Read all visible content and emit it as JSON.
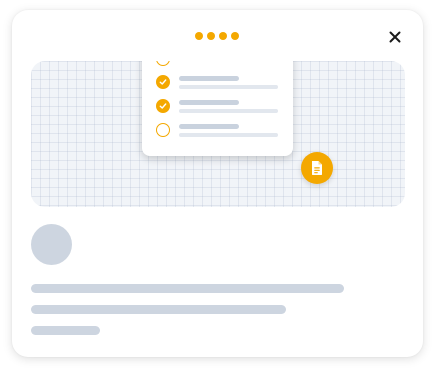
{
  "modal": {
    "step_indicator": {
      "total_steps": 4,
      "active_color": "#f4a800"
    },
    "close_icon": "close-icon",
    "illustration": {
      "checklist": [
        {
          "checked": false
        },
        {
          "checked": true
        },
        {
          "checked": true
        },
        {
          "checked": false
        }
      ],
      "badge_icon": "document-icon",
      "accent_color": "#f4a800"
    },
    "content": {
      "avatar_placeholder": true,
      "text_placeholder_lines": 3
    }
  }
}
